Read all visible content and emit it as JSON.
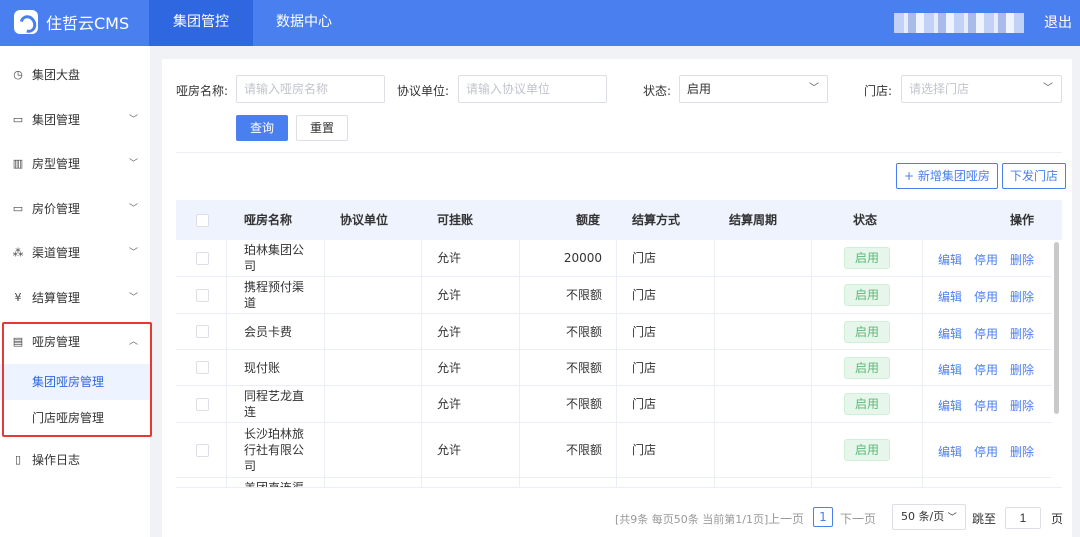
{
  "app": {
    "name": "住哲云CMS"
  },
  "topnav": {
    "tabs": [
      {
        "label": "集团管控"
      },
      {
        "label": "数据中心"
      }
    ],
    "logout": "退出"
  },
  "sidebar": {
    "items": [
      {
        "label": "集团大盘"
      },
      {
        "label": "集团管理"
      },
      {
        "label": "房型管理"
      },
      {
        "label": "房价管理"
      },
      {
        "label": "渠道管理"
      },
      {
        "label": "结算管理"
      },
      {
        "label": "哑房管理"
      },
      {
        "label": "操作日志"
      }
    ],
    "subitems": [
      {
        "label": "集团哑房管理"
      },
      {
        "label": "门店哑房管理"
      }
    ]
  },
  "filters": {
    "name_label": "哑房名称:",
    "name_placeholder": "请输入哑房名称",
    "unit_label": "协议单位:",
    "unit_placeholder": "请输入协议单位",
    "status_label": "状态:",
    "status_value": "启用",
    "store_label": "门店:",
    "store_placeholder": "请选择门店",
    "query_button": "查询",
    "reset_button": "重置"
  },
  "actions": {
    "add_button": "+ 新增集团哑房",
    "dispatch_button": "下发门店"
  },
  "table": {
    "headers": [
      "哑房名称",
      "协议单位",
      "可挂账",
      "额度",
      "结算方式",
      "结算周期",
      "状态",
      "操作"
    ],
    "rows": [
      {
        "name": "珀林集团公司",
        "unit": "",
        "credit": "允许",
        "limit": "20000",
        "settle": "门店",
        "period": "",
        "status": "启用"
      },
      {
        "name": "携程预付渠道",
        "unit": "",
        "credit": "允许",
        "limit": "不限额",
        "settle": "门店",
        "period": "",
        "status": "启用"
      },
      {
        "name": "会员卡费",
        "unit": "",
        "credit": "允许",
        "limit": "不限额",
        "settle": "门店",
        "period": "",
        "status": "启用"
      },
      {
        "name": "现付账",
        "unit": "",
        "credit": "允许",
        "limit": "不限额",
        "settle": "门店",
        "period": "",
        "status": "启用"
      },
      {
        "name": "同程艺龙直连",
        "unit": "",
        "credit": "允许",
        "limit": "不限额",
        "settle": "门店",
        "period": "",
        "status": "启用"
      },
      {
        "name": "长沙珀林旅行社有限公司",
        "unit": "",
        "credit": "允许",
        "limit": "不限额",
        "settle": "门店",
        "period": "",
        "status": "启用"
      },
      {
        "name": "美团直连渠",
        "unit": "",
        "credit": "",
        "limit": "",
        "settle": "",
        "period": "",
        "status": ""
      }
    ],
    "ops": {
      "edit": "编辑",
      "disable": "停用",
      "delete": "删除"
    }
  },
  "pagination": {
    "summary": "[共9条 每页50条 当前第1/1页]",
    "prev": "上一页",
    "current": "1",
    "next": "下一页",
    "page_size": "50 条/页",
    "jump_label": "跳至",
    "jump_value": "1",
    "page_unit": "页"
  }
}
